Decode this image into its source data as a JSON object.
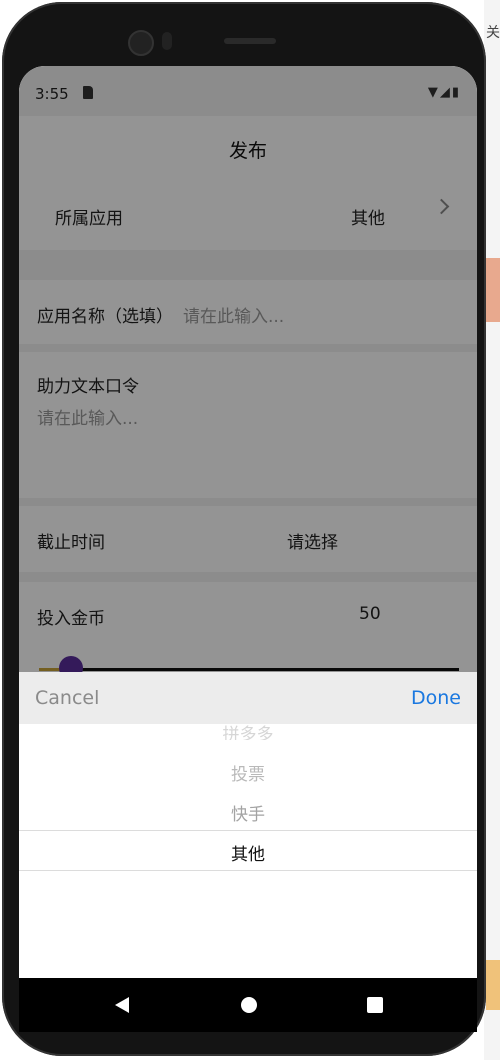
{
  "background_app": {
    "visible_char": "关"
  },
  "status_bar": {
    "time": "3:55",
    "icons": "▼◢▮"
  },
  "page": {
    "title": "发布"
  },
  "form": {
    "app_category": {
      "label": "所属应用",
      "value": "其他"
    },
    "app_name": {
      "label": "应用名称（选填）",
      "placeholder": "请在此输入..."
    },
    "help_text": {
      "label": "助力文本口令",
      "placeholder": "请在此输入..."
    },
    "deadline": {
      "label": "截止时间",
      "value": "请选择"
    },
    "coins": {
      "label": "投入金币",
      "value": "50"
    }
  },
  "picker": {
    "cancel_label": "Cancel",
    "done_label": "Done",
    "options": [
      "拼多多",
      "投票",
      "快手",
      "其他"
    ],
    "selected": "其他"
  },
  "colors": {
    "accent": "#1a78e0",
    "slider_thumb": "#5a2d9c",
    "overlay": "rgba(0,0,0,0.42)"
  },
  "nav": {
    "back_icon": "back-triangle",
    "home_icon": "home-circle",
    "recents_icon": "recents-square"
  }
}
